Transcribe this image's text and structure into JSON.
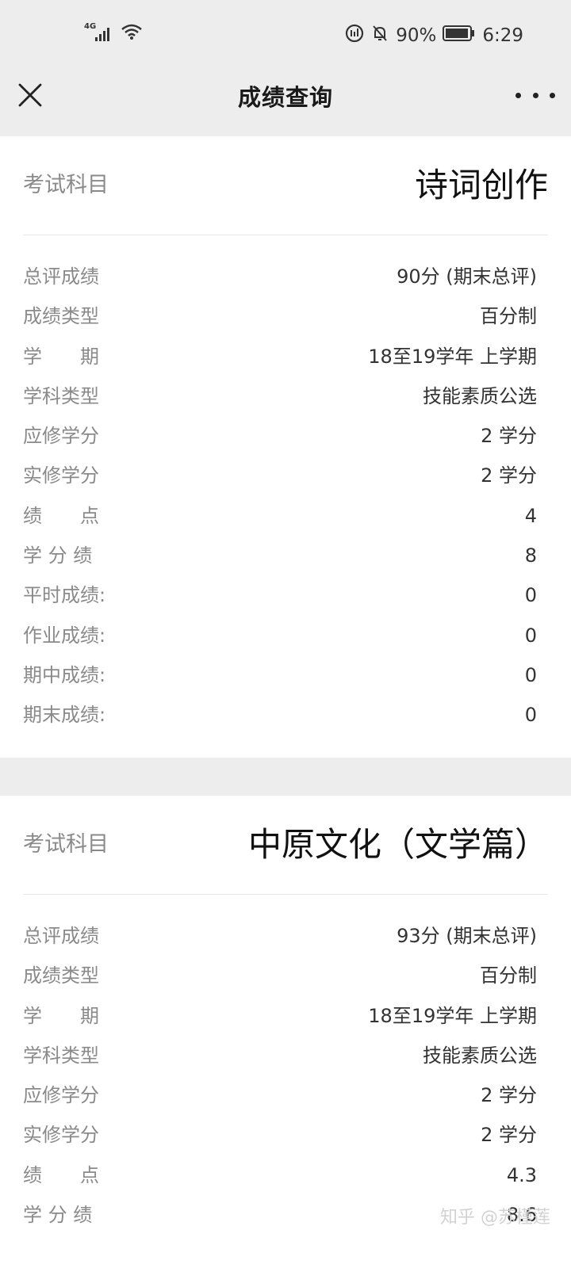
{
  "status_bar": {
    "network": "4G",
    "battery": "90%",
    "time": "6:29"
  },
  "header": {
    "title": "成绩查询"
  },
  "records": [
    {
      "subject_label": "考试科目",
      "subject": "诗词创作",
      "fields": [
        {
          "label": "总评成绩",
          "value": "90分 (期末总评)"
        },
        {
          "label": "成绩类型",
          "value": "百分制"
        },
        {
          "label": "学　　期",
          "value": "18至19学年 上学期"
        },
        {
          "label": "学科类型",
          "value": "技能素质公选"
        },
        {
          "label": "应修学分",
          "value": "2 学分"
        },
        {
          "label": "实修学分",
          "value": "2 学分"
        },
        {
          "label": "绩　　点",
          "value": "4"
        },
        {
          "label": "学 分 绩",
          "value": "8"
        },
        {
          "label": "平时成绩:",
          "value": "0"
        },
        {
          "label": "作业成绩:",
          "value": "0"
        },
        {
          "label": "期中成绩:",
          "value": "0"
        },
        {
          "label": "期末成绩:",
          "value": "0"
        }
      ]
    },
    {
      "subject_label": "考试科目",
      "subject": "中原文化（文学篇）",
      "fields": [
        {
          "label": "总评成绩",
          "value": "93分 (期末总评)"
        },
        {
          "label": "成绩类型",
          "value": "百分制"
        },
        {
          "label": "学　　期",
          "value": "18至19学年 上学期"
        },
        {
          "label": "学科类型",
          "value": "技能素质公选"
        },
        {
          "label": "应修学分",
          "value": "2 学分"
        },
        {
          "label": "实修学分",
          "value": "2 学分"
        },
        {
          "label": "绩　　点",
          "value": "4.3"
        },
        {
          "label": "学 分 绩",
          "value": "8.6"
        }
      ]
    }
  ],
  "watermark": "知乎 @苏槿莲",
  "icons": {
    "close": "close-icon",
    "more": "more-icon",
    "signal": "signal-icon",
    "wifi": "wifi-icon",
    "battery": "battery-icon",
    "mute": "bell-off-icon"
  }
}
